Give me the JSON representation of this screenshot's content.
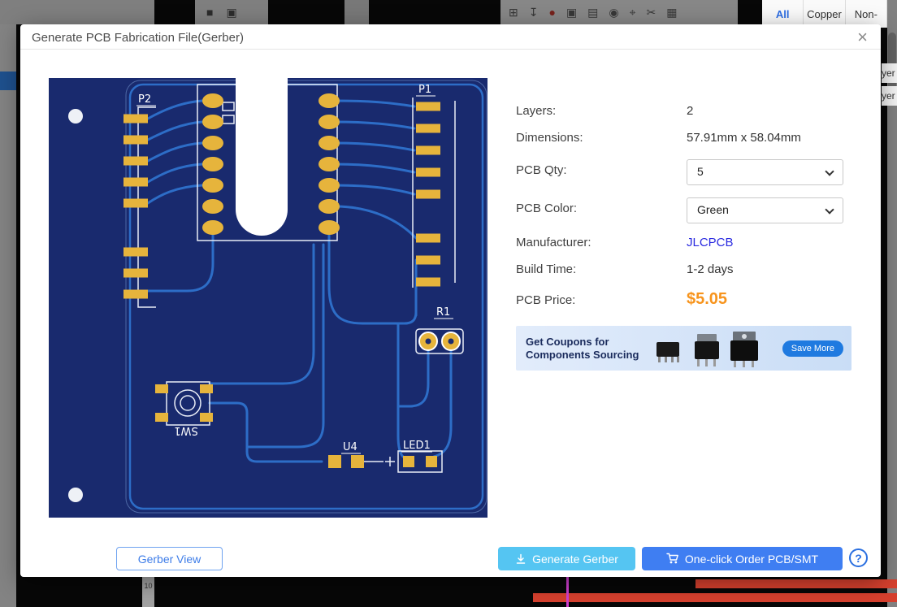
{
  "app": {
    "layer_panel_tabs": [
      {
        "label": "All"
      },
      {
        "label": "Copper"
      },
      {
        "label": "Non-"
      }
    ],
    "layer_fragments": [
      {
        "label": "yer"
      },
      {
        "label": "yer"
      }
    ],
    "ruler_label": "10",
    "left_toolbar_icons": [
      {
        "name": "tool-a-icon",
        "glyph": "■"
      },
      {
        "name": "tool-b-icon",
        "glyph": "▣"
      }
    ],
    "toolbar_icons": [
      {
        "name": "grid-icon",
        "glyph": "⊞"
      },
      {
        "name": "export-icon",
        "glyph": "↧"
      },
      {
        "name": "record-icon",
        "glyph": "●"
      },
      {
        "name": "panel-icon",
        "glyph": "▣"
      },
      {
        "name": "print-icon",
        "glyph": "▤"
      },
      {
        "name": "target-icon",
        "glyph": "◉"
      },
      {
        "name": "crosshair-icon",
        "glyph": "⌖"
      },
      {
        "name": "cut-icon",
        "glyph": "✂"
      },
      {
        "name": "layers-icon",
        "glyph": "▦"
      }
    ]
  },
  "dialog": {
    "title": "Generate PCB Fabrication File(Gerber)",
    "close_glyph": "×"
  },
  "pcb": {
    "labels": {
      "p1": "P1",
      "p2": "P2",
      "r1": "R1",
      "sw1": "SW1",
      "u4": "U4",
      "led1": "LED1"
    }
  },
  "info": {
    "layers_label": "Layers:",
    "layers_value": "2",
    "dimensions_label": "Dimensions:",
    "dimensions_value": "57.91mm x 58.04mm",
    "qty_label": "PCB Qty:",
    "qty_value": "5",
    "color_label": "PCB Color:",
    "color_value": "Green",
    "manufacturer_label": "Manufacturer:",
    "manufacturer_value": "JLCPCB",
    "build_label": "Build Time:",
    "build_value": "1-2 days",
    "price_label": "PCB Price:",
    "price_value": "$5.05"
  },
  "banner": {
    "title_line1": "Get Coupons for",
    "title_line2": "Components Sourcing",
    "button_label": "Save More"
  },
  "footer": {
    "gerber_view_label": "Gerber View",
    "generate_gerber_label": "Generate Gerber",
    "order_label": "One-click Order PCB/SMT",
    "help_label": "?"
  },
  "colors": {
    "price": "#f7941d",
    "manufacturer_link": "#2a2ae0",
    "primary_blue": "#3f7ef2",
    "cyan_button": "#55c5f2",
    "pcb_board": "#192a6e",
    "pcb_trace": "#2d6dc7",
    "pcb_pad": "#e6b43c"
  }
}
